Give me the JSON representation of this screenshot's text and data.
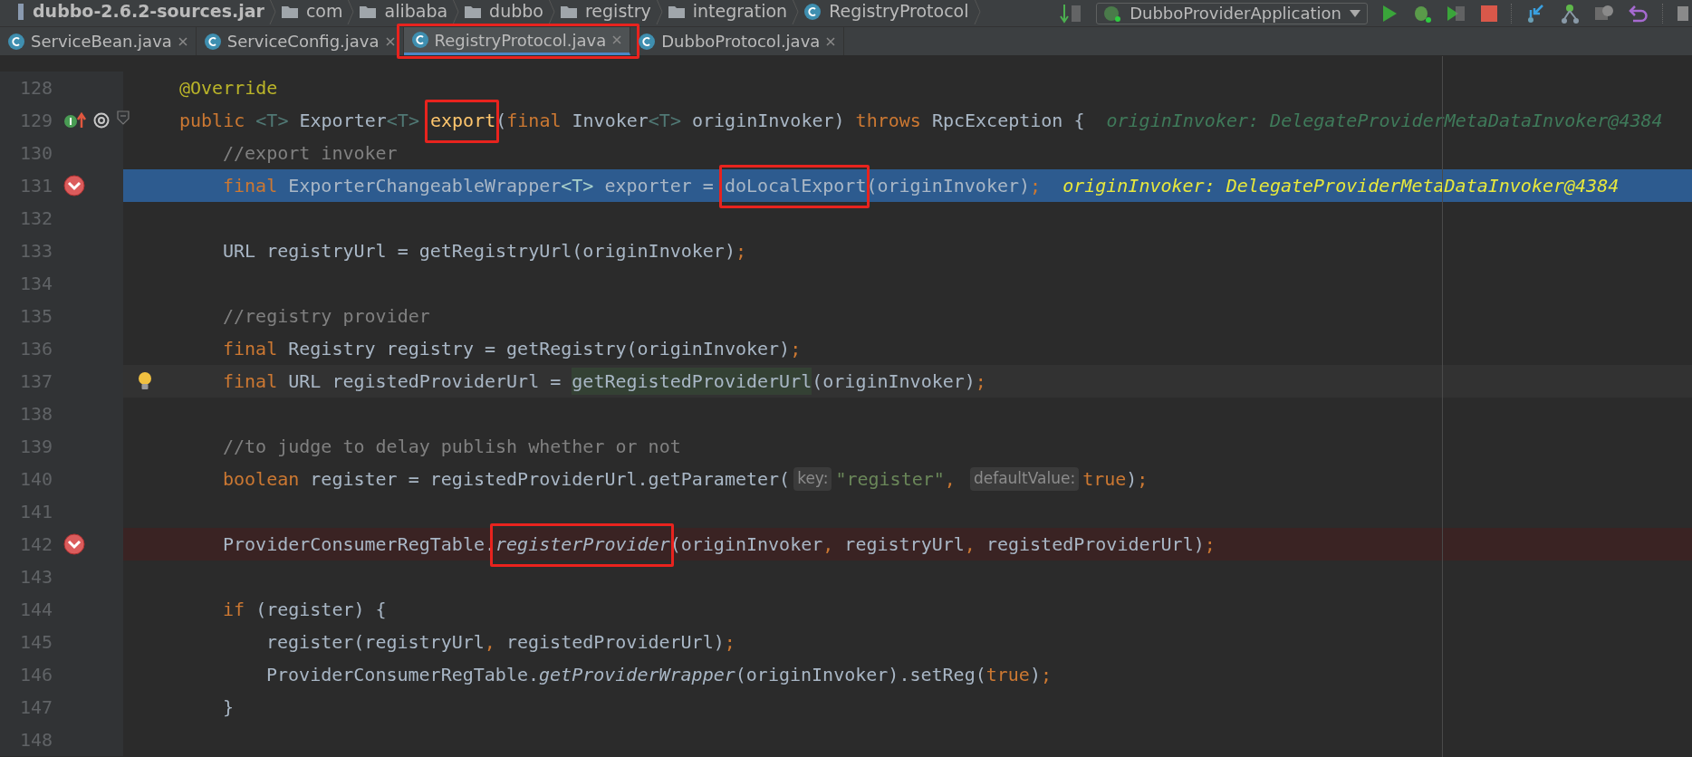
{
  "breadcrumbs": [
    {
      "label": "dubbo-2.6.2-sources.jar",
      "kind": "jar"
    },
    {
      "label": "com",
      "kind": "folder"
    },
    {
      "label": "alibaba",
      "kind": "folder"
    },
    {
      "label": "dubbo",
      "kind": "folder"
    },
    {
      "label": "registry",
      "kind": "folder"
    },
    {
      "label": "integration",
      "kind": "folder"
    },
    {
      "label": "RegistryProtocol",
      "kind": "class"
    }
  ],
  "run_config": {
    "label": "DubboProviderApplication"
  },
  "tabs": [
    {
      "label": "ServiceBean.java",
      "selected": false,
      "boxed": false
    },
    {
      "label": "ServiceConfig.java",
      "selected": false,
      "boxed": false
    },
    {
      "label": "RegistryProtocol.java",
      "selected": true,
      "boxed": true
    },
    {
      "label": "DubboProtocol.java",
      "selected": false,
      "boxed": false
    }
  ],
  "lines": [
    {
      "number": "128",
      "tokens": [
        {
          "kind": "annotation",
          "text": "@Override"
        }
      ]
    },
    {
      "number": "129",
      "implements_marker": true,
      "override_marker": true,
      "foldable": true,
      "tokens": [
        {
          "kind": "keyword",
          "text": "public "
        },
        {
          "kind": "typeparam",
          "text": "<T> "
        },
        {
          "kind": "plain",
          "text": "Exporter"
        },
        {
          "kind": "typeparam",
          "text": "<T> "
        },
        {
          "kind": "decl",
          "text": "export",
          "boxed": true
        },
        {
          "kind": "plain",
          "text": "("
        },
        {
          "kind": "keyword",
          "text": "final "
        },
        {
          "kind": "plain",
          "text": "Invoker"
        },
        {
          "kind": "typeparam",
          "text": "<T>"
        },
        {
          "kind": "plain",
          "text": " originInvoker) "
        },
        {
          "kind": "keyword",
          "text": "throws "
        },
        {
          "kind": "plain",
          "text": "RpcException {"
        },
        {
          "kind": "debug",
          "text": "originInvoker: DelegateProviderMetaDataInvoker@4384"
        }
      ],
      "children": [
        {
          "number": "130",
          "tokens": [
            {
              "kind": "comment",
              "text": "//export invoker"
            }
          ]
        },
        {
          "number": "131",
          "current_execution": true,
          "breakpoint": true,
          "tokens": [
            {
              "kind": "keyword",
              "text": "final "
            },
            {
              "kind": "plain",
              "text": "ExporterChangeableWrapper"
            },
            {
              "kind": "typeparam",
              "text": "<T>"
            },
            {
              "kind": "plain",
              "text": " exporter = "
            },
            {
              "kind": "plain",
              "text": "doLocalExport",
              "boxed": true
            },
            {
              "kind": "plain",
              "text": "(originInvoker)"
            },
            {
              "kind": "punct",
              "text": ";"
            },
            {
              "kind": "debug",
              "text": "originInvoker: DelegateProviderMetaDataInvoker@4384"
            }
          ]
        },
        {
          "number": "132"
        },
        {
          "number": "133",
          "tokens": [
            {
              "kind": "plain",
              "text": "URL registryUrl = getRegistryUrl(originInvoker)"
            },
            {
              "kind": "punct",
              "text": ";"
            }
          ]
        },
        {
          "number": "134"
        },
        {
          "number": "135",
          "tokens": [
            {
              "kind": "comment",
              "text": "//registry provider"
            }
          ]
        },
        {
          "number": "136",
          "tokens": [
            {
              "kind": "keyword",
              "text": "final "
            },
            {
              "kind": "plain",
              "text": "Registry registry = getRegistry(originInvoker)"
            },
            {
              "kind": "punct",
              "text": ";"
            }
          ]
        },
        {
          "number": "137",
          "caret_line": true,
          "intention_bulb": true,
          "tokens": [
            {
              "kind": "keyword",
              "text": "final "
            },
            {
              "kind": "plain",
              "text": "URL registedProviderUrl = "
            },
            {
              "kind": "usage",
              "text": "getRegistedProviderUrl"
            },
            {
              "kind": "plain",
              "text": "(originInvoker)"
            },
            {
              "kind": "punct",
              "text": ";"
            }
          ]
        },
        {
          "number": "138"
        },
        {
          "number": "139",
          "tokens": [
            {
              "kind": "comment",
              "text": "//to judge to delay publish whether or not"
            }
          ]
        },
        {
          "number": "140",
          "tokens": [
            {
              "kind": "keyword",
              "text": "boolean "
            },
            {
              "kind": "plain",
              "text": "register = registedProviderUrl.getParameter("
            },
            {
              "kind": "hint",
              "text": "key:"
            },
            {
              "kind": "string",
              "text": "\"register\""
            },
            {
              "kind": "punct",
              "text": ", "
            },
            {
              "kind": "hint",
              "text": "defaultValue:"
            },
            {
              "kind": "keyword",
              "text": "true"
            },
            {
              "kind": "plain",
              "text": ")"
            },
            {
              "kind": "punct",
              "text": ";"
            }
          ]
        },
        {
          "number": "141"
        },
        {
          "number": "142",
          "breakpoint": true,
          "tokens": [
            {
              "kind": "plain",
              "text": "ProviderConsumerRegTable."
            },
            {
              "kind": "static",
              "text": "registerProvider",
              "boxed": true
            },
            {
              "kind": "plain",
              "text": "(originInvoker"
            },
            {
              "kind": "punct",
              "text": ", "
            },
            {
              "kind": "plain",
              "text": "registryUrl"
            },
            {
              "kind": "punct",
              "text": ", "
            },
            {
              "kind": "plain",
              "text": "registedProviderUrl)"
            },
            {
              "kind": "punct",
              "text": ";"
            }
          ]
        },
        {
          "number": "143"
        },
        {
          "number": "144",
          "tokens": [
            {
              "kind": "keyword",
              "text": "if "
            },
            {
              "kind": "plain",
              "text": "(register) {"
            }
          ],
          "children": [
            {
              "number": "145",
              "tokens": [
                {
                  "kind": "plain",
                  "text": "register(registryUrl"
                },
                {
                  "kind": "punct",
                  "text": ", "
                },
                {
                  "kind": "plain",
                  "text": "registedProviderUrl)"
                },
                {
                  "kind": "punct",
                  "text": ";"
                }
              ]
            },
            {
              "number": "146",
              "tokens": [
                {
                  "kind": "plain",
                  "text": "ProviderConsumerRegTable."
                },
                {
                  "kind": "static",
                  "text": "getProviderWrapper"
                },
                {
                  "kind": "plain",
                  "text": "(originInvoker).setReg("
                },
                {
                  "kind": "keyword",
                  "text": "true"
                },
                {
                  "kind": "plain",
                  "text": ")"
                },
                {
                  "kind": "punct",
                  "text": ";"
                }
              ]
            }
          ]
        },
        {
          "number": "147",
          "tokens": [
            {
              "kind": "plain",
              "text": "}"
            }
          ]
        },
        {
          "number": "148"
        }
      ]
    }
  ]
}
